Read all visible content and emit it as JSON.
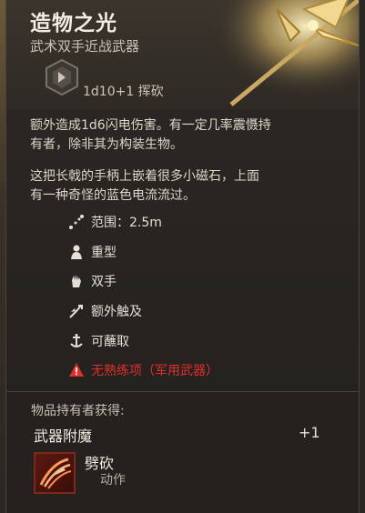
{
  "item": {
    "name": "造物之光",
    "type": "武术双手近战武器",
    "damage": "1d10+1 挥砍",
    "description": "额外造成1d6闪电伤害。有一定几率震慑持有者，除非其为构装生物。这把长戟的手柄上嵌着很多小磁石，上面有一种奇怪的蓝色电流流过。"
  },
  "properties": [
    {
      "icon": "range-icon",
      "label": "范围：2.5m"
    },
    {
      "icon": "heavy-icon",
      "label": "重型"
    },
    {
      "icon": "two-handed-icon",
      "label": "双手"
    },
    {
      "icon": "reach-icon",
      "label": "额外触及"
    },
    {
      "icon": "dippable-icon",
      "label": "可蘸取"
    },
    {
      "icon": "warning-icon",
      "label": "无熟练项（军用武器）",
      "color": "#e0302b"
    }
  ],
  "footer": {
    "gains_label": "物品持有者获得:",
    "enchant_label": "武器附魔",
    "enchant_value": "+1",
    "action_name": "劈砍",
    "action_type": "动作"
  },
  "colors": {
    "warning": "#e0302b",
    "background": "#2a2623"
  }
}
